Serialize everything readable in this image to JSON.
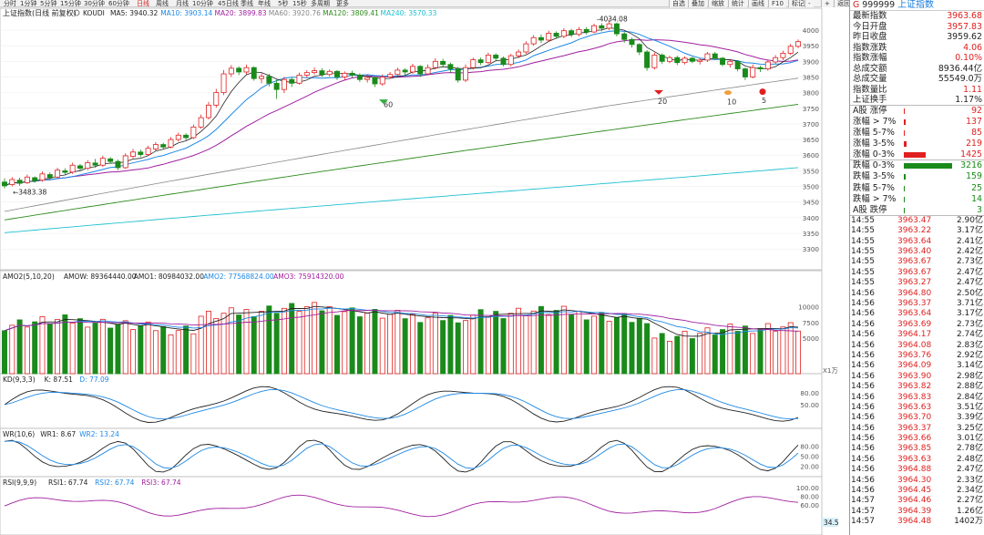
{
  "period_tabs": [
    "分时",
    "1分钟",
    "5分钟",
    "15分钟",
    "30分钟",
    "60分钟",
    "日线",
    "周线",
    "月线",
    "10分钟",
    "45日线",
    "季线",
    "年线",
    "5秒",
    "15秒",
    "多周期",
    "更多"
  ],
  "active_period": "日线",
  "right_buttons": [
    "自选",
    "叠加",
    "缩放",
    "统计",
    "画线",
    "F10",
    "标记",
    "-",
    "+",
    "返回"
  ],
  "price_panel": {
    "title": "上证指数(日线 前复权)",
    "indicator_name": "KOUDI",
    "legend": [
      {
        "label": "MA5: 3940.32",
        "color": "#222222"
      },
      {
        "label": "MA10: 3903.14",
        "color": "#1e88e5"
      },
      {
        "label": "MA20: 3899.83",
        "color": "#a020a0"
      },
      {
        "label": "MA60: 3920.76",
        "color": "#888888"
      },
      {
        "label": "MA120: 3809.41",
        "color": "#2e8b1e"
      },
      {
        "label": "MA240: 3570.33",
        "color": "#20c0d0"
      }
    ],
    "yticks": [
      4000,
      3950,
      3900,
      3850,
      3800,
      3750,
      3700,
      3650,
      3600,
      3550,
      3500,
      3450,
      3400,
      3350,
      3300
    ],
    "ylim": [
      3300,
      4000
    ],
    "annotations": {
      "high": "4034.08",
      "low": "3483.38",
      "m60": "60",
      "m20": "20",
      "m10": "10",
      "m5": "5"
    }
  },
  "amo_panel": {
    "title": "AMO2(5,10,20)",
    "legend": [
      {
        "label": "AMOW: 89364440.00",
        "color": "#222222"
      },
      {
        "label": "AMO1: 80984032.00",
        "color": "#222222"
      },
      {
        "label": "AMO2: 77568824.00",
        "color": "#1e88e5"
      },
      {
        "label": "AMO3: 75914320.00",
        "color": "#a020a0"
      }
    ],
    "yticks": [
      "10000",
      "7500",
      "5000"
    ],
    "unit": "X1万"
  },
  "kd_panel": {
    "title": "KD(9,3,3)",
    "legend": [
      {
        "label": "K: 87.51",
        "color": "#222222"
      },
      {
        "label": "D: 77.09",
        "color": "#1e88e5"
      }
    ],
    "yticks": [
      "80.00",
      "50.00"
    ]
  },
  "wr_panel": {
    "title": "WR(10,6)",
    "legend": [
      {
        "label": "WR1: 8.67",
        "color": "#222222"
      },
      {
        "label": "WR2: 13.24",
        "color": "#1e88e5"
      }
    ],
    "yticks": [
      "80.00",
      "50.00",
      "20.00"
    ]
  },
  "rsi_panel": {
    "title": "RSI(9,9,9)",
    "legend": [
      {
        "label": "RSI1: 67.74",
        "color": "#222222"
      },
      {
        "label": "RSI2: 67.74",
        "color": "#1e88e5"
      },
      {
        "label": "RSI3: 67.74",
        "color": "#a020a0"
      }
    ],
    "yticks": [
      "100.00",
      "80.00",
      "60.00"
    ],
    "current": "34.5"
  },
  "chart_data": {
    "type": "candlestick",
    "title": "上证指数(日线 前复权)",
    "ylim": [
      3300,
      4000
    ],
    "candles": [
      [
        3514,
        3502,
        3526,
        3494
      ],
      [
        3506,
        3522,
        3530,
        3500
      ],
      [
        3520,
        3510,
        3528,
        3502
      ],
      [
        3512,
        3530,
        3538,
        3508
      ],
      [
        3528,
        3518,
        3532,
        3512
      ],
      [
        3520,
        3540,
        3548,
        3515
      ],
      [
        3538,
        3528,
        3545,
        3522
      ],
      [
        3530,
        3552,
        3560,
        3526
      ],
      [
        3550,
        3545,
        3558,
        3538
      ],
      [
        3546,
        3568,
        3576,
        3540
      ],
      [
        3566,
        3558,
        3572,
        3550
      ],
      [
        3558,
        3576,
        3584,
        3552
      ],
      [
        3575,
        3568,
        3588,
        3560
      ],
      [
        3568,
        3590,
        3598,
        3562
      ],
      [
        3588,
        3580,
        3594,
        3572
      ],
      [
        3580,
        3560,
        3586,
        3552
      ],
      [
        3560,
        3598,
        3606,
        3556
      ],
      [
        3596,
        3610,
        3620,
        3590
      ],
      [
        3610,
        3602,
        3618,
        3594
      ],
      [
        3602,
        3622,
        3630,
        3598
      ],
      [
        3620,
        3634,
        3642,
        3614
      ],
      [
        3634,
        3626,
        3640,
        3618
      ],
      [
        3626,
        3650,
        3658,
        3622
      ],
      [
        3650,
        3664,
        3672,
        3644
      ],
      [
        3664,
        3656,
        3670,
        3648
      ],
      [
        3656,
        3690,
        3698,
        3652
      ],
      [
        3690,
        3720,
        3730,
        3684
      ],
      [
        3720,
        3760,
        3770,
        3714
      ],
      [
        3760,
        3800,
        3812,
        3752
      ],
      [
        3800,
        3860,
        3872,
        3792
      ],
      [
        3860,
        3878,
        3888,
        3850
      ],
      [
        3878,
        3866,
        3884,
        3856
      ],
      [
        3866,
        3880,
        3890,
        3858
      ],
      [
        3880,
        3845,
        3884,
        3838
      ],
      [
        3845,
        3852,
        3862,
        3830
      ],
      [
        3852,
        3830,
        3860,
        3820
      ],
      [
        3830,
        3810,
        3842,
        3780
      ],
      [
        3810,
        3842,
        3850,
        3798
      ],
      [
        3842,
        3830,
        3850,
        3818
      ],
      [
        3830,
        3856,
        3864,
        3826
      ],
      [
        3856,
        3864,
        3872,
        3848
      ],
      [
        3864,
        3870,
        3880,
        3858
      ],
      [
        3870,
        3858,
        3878,
        3850
      ],
      [
        3858,
        3868,
        3874,
        3852
      ],
      [
        3868,
        3850,
        3872,
        3840
      ],
      [
        3850,
        3862,
        3868,
        3840
      ],
      [
        3862,
        3856,
        3870,
        3848
      ],
      [
        3856,
        3842,
        3862,
        3834
      ],
      [
        3842,
        3848,
        3856,
        3832
      ],
      [
        3848,
        3828,
        3852,
        3818
      ],
      [
        3828,
        3850,
        3858,
        3822
      ],
      [
        3850,
        3858,
        3866,
        3844
      ],
      [
        3858,
        3872,
        3880,
        3852
      ],
      [
        3872,
        3866,
        3878,
        3856
      ],
      [
        3866,
        3884,
        3892,
        3860
      ],
      [
        3884,
        3860,
        3888,
        3850
      ],
      [
        3860,
        3880,
        3890,
        3856
      ],
      [
        3880,
        3900,
        3910,
        3874
      ],
      [
        3900,
        3890,
        3908,
        3880
      ],
      [
        3890,
        3876,
        3896,
        3864
      ],
      [
        3876,
        3840,
        3882,
        3832
      ],
      [
        3840,
        3880,
        3890,
        3834
      ],
      [
        3880,
        3905,
        3912,
        3874
      ],
      [
        3905,
        3896,
        3912,
        3888
      ],
      [
        3896,
        3920,
        3928,
        3892
      ],
      [
        3920,
        3910,
        3926,
        3900
      ],
      [
        3910,
        3890,
        3916,
        3884
      ],
      [
        3890,
        3918,
        3924,
        3884
      ],
      [
        3918,
        3930,
        3938,
        3910
      ],
      [
        3930,
        3956,
        3964,
        3924
      ],
      [
        3956,
        3976,
        3984,
        3950
      ],
      [
        3976,
        3968,
        3986,
        3958
      ],
      [
        3968,
        3990,
        3998,
        3962
      ],
      [
        3990,
        3980,
        3996,
        3972
      ],
      [
        3980,
        3998,
        4006,
        3974
      ],
      [
        3998,
        3986,
        4004,
        3978
      ],
      [
        3986,
        4002,
        4010,
        3980
      ],
      [
        4002,
        3994,
        4010,
        3986
      ],
      [
        3994,
        4014,
        4020,
        3990
      ],
      [
        4014,
        4006,
        4022,
        3996
      ],
      [
        4006,
        4020,
        4034,
        4000
      ],
      [
        4020,
        3988,
        4024,
        3980
      ],
      [
        3988,
        3970,
        3994,
        3960
      ],
      [
        3970,
        3954,
        3976,
        3944
      ],
      [
        3954,
        3930,
        3958,
        3920
      ],
      [
        3930,
        3880,
        3936,
        3870
      ],
      [
        3880,
        3920,
        3928,
        3874
      ],
      [
        3920,
        3900,
        3926,
        3892
      ],
      [
        3900,
        3912,
        3918,
        3894
      ],
      [
        3912,
        3896,
        3918,
        3888
      ],
      [
        3896,
        3910,
        3916,
        3890
      ],
      [
        3910,
        3900,
        3914,
        3894
      ],
      [
        3900,
        3904,
        3910,
        3890
      ],
      [
        3904,
        3924,
        3930,
        3898
      ],
      [
        3924,
        3910,
        3930,
        3904
      ],
      [
        3910,
        3890,
        3914,
        3884
      ],
      [
        3890,
        3900,
        3906,
        3880
      ],
      [
        3900,
        3876,
        3904,
        3868
      ],
      [
        3876,
        3850,
        3880,
        3840
      ],
      [
        3850,
        3880,
        3890,
        3846
      ],
      [
        3880,
        3876,
        3886,
        3866
      ],
      [
        3876,
        3898,
        3904,
        3870
      ],
      [
        3898,
        3912,
        3920,
        3892
      ],
      [
        3912,
        3926,
        3934,
        3904
      ],
      [
        3926,
        3948,
        3956,
        3920
      ],
      [
        3948,
        3963,
        3970,
        3942
      ]
    ]
  },
  "right_panel": {
    "code": "999999",
    "name": "上证指数",
    "g": "G",
    "quote": [
      {
        "label": "最新指数",
        "value": "3963.68",
        "cls": "red"
      },
      {
        "label": "今日开盘",
        "value": "3957.83",
        "cls": "red"
      },
      {
        "label": "昨日收盘",
        "value": "3959.62",
        "cls": "dark"
      },
      {
        "label": "指数涨跌",
        "value": "4.06",
        "cls": "red"
      },
      {
        "label": "指数涨幅",
        "value": "0.10%",
        "cls": "red"
      },
      {
        "label": "总成交额",
        "value": "8936.44亿",
        "cls": "dark"
      },
      {
        "label": "总成交量",
        "value": "55549.0万",
        "cls": "dark"
      },
      {
        "label": "指数量比",
        "value": "1.11",
        "cls": "red"
      },
      {
        "label": "上证换手",
        "value": "1.17%",
        "cls": "dark"
      }
    ],
    "breadth_up": [
      {
        "label": "A股 涨停",
        "value": "92",
        "ratio": 0.008
      },
      {
        "label": "涨幅 > 7%",
        "value": "137",
        "ratio": 0.012
      },
      {
        "label": "涨幅 5-7%",
        "value": "85",
        "ratio": 0.008
      },
      {
        "label": "涨幅 3-5%",
        "value": "219",
        "ratio": 0.02
      },
      {
        "label": "涨幅 0-3%",
        "value": "1425",
        "ratio": 0.15
      }
    ],
    "breadth_down": [
      {
        "label": "跌幅 0-3%",
        "value": "3216",
        "ratio": 0.33
      },
      {
        "label": "跌幅 3-5%",
        "value": "159",
        "ratio": 0.012
      },
      {
        "label": "跌幅 5-7%",
        "value": "25",
        "ratio": 0.003
      },
      {
        "label": "跌幅 > 7%",
        "value": "14",
        "ratio": 0.002
      },
      {
        "label": "A股 跌停",
        "value": "3",
        "ratio": 0.001
      }
    ],
    "ticks": [
      [
        "14:55",
        "3963.47",
        "2.90亿"
      ],
      [
        "14:55",
        "3963.22",
        "3.17亿"
      ],
      [
        "14:55",
        "3963.64",
        "2.41亿"
      ],
      [
        "14:55",
        "3963.40",
        "2.42亿"
      ],
      [
        "14:55",
        "3963.67",
        "2.73亿"
      ],
      [
        "14:55",
        "3963.67",
        "2.47亿"
      ],
      [
        "14:55",
        "3963.27",
        "2.47亿"
      ],
      [
        "14:56",
        "3964.80",
        "2.50亿"
      ],
      [
        "14:56",
        "3963.37",
        "3.71亿"
      ],
      [
        "14:56",
        "3963.64",
        "3.17亿"
      ],
      [
        "14:56",
        "3963.69",
        "2.73亿"
      ],
      [
        "14:56",
        "3964.17",
        "2.74亿"
      ],
      [
        "14:56",
        "3964.08",
        "2.83亿"
      ],
      [
        "14:56",
        "3963.76",
        "2.92亿"
      ],
      [
        "14:56",
        "3964.09",
        "3.14亿"
      ],
      [
        "14:56",
        "3963.90",
        "2.98亿"
      ],
      [
        "14:56",
        "3963.82",
        "2.88亿"
      ],
      [
        "14:56",
        "3963.83",
        "2.84亿"
      ],
      [
        "14:56",
        "3963.63",
        "3.51亿"
      ],
      [
        "14:56",
        "3963.70",
        "3.39亿"
      ],
      [
        "14:56",
        "3963.37",
        "3.25亿"
      ],
      [
        "14:56",
        "3963.66",
        "3.01亿"
      ],
      [
        "14:56",
        "3963.85",
        "2.78亿"
      ],
      [
        "14:56",
        "3963.63",
        "2.48亿"
      ],
      [
        "14:56",
        "3964.88",
        "2.47亿"
      ],
      [
        "14:56",
        "3964.30",
        "2.33亿"
      ],
      [
        "14:56",
        "3964.45",
        "2.34亿"
      ],
      [
        "14:57",
        "3964.46",
        "2.27亿"
      ],
      [
        "14:57",
        "3964.39",
        "1.26亿"
      ],
      [
        "14:57",
        "3964.48",
        "1402万"
      ]
    ]
  }
}
